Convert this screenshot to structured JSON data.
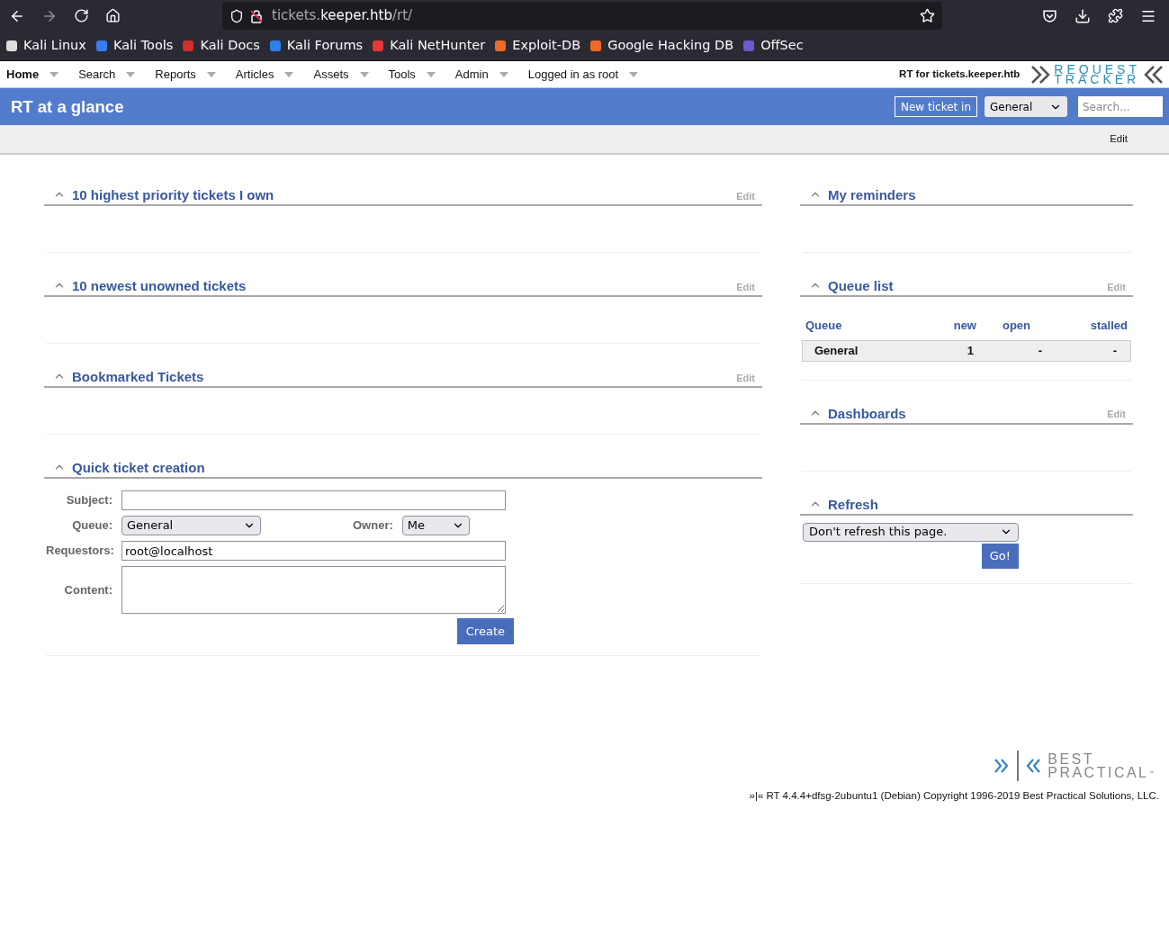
{
  "browser": {
    "url": {
      "subdomain": "tickets.",
      "domain": "keeper.htb",
      "path": "/rt/"
    },
    "bookmarks": [
      {
        "label": "Kali Linux",
        "color": "#dddddd"
      },
      {
        "label": "Kali Tools",
        "color": "#367bf0"
      },
      {
        "label": "Kali Docs",
        "color": "#d32f2f"
      },
      {
        "label": "Kali Forums",
        "color": "#2f80ed"
      },
      {
        "label": "Kali NetHunter",
        "color": "#e53935"
      },
      {
        "label": "Exploit-DB",
        "color": "#f06a2b"
      },
      {
        "label": "Google Hacking DB",
        "color": "#f06a2b"
      },
      {
        "label": "OffSec",
        "color": "#6a5acd"
      }
    ]
  },
  "menu": {
    "items": [
      {
        "label": "Home",
        "selected": true
      },
      {
        "label": "Search",
        "selected": false
      },
      {
        "label": "Reports",
        "selected": false
      },
      {
        "label": "Articles",
        "selected": false
      },
      {
        "label": "Assets",
        "selected": false
      },
      {
        "label": "Tools",
        "selected": false
      },
      {
        "label": "Admin",
        "selected": false
      },
      {
        "label": "Logged in as root",
        "selected": false
      }
    ],
    "site_title": "RT for tickets.keeper.htb",
    "logo": {
      "line1": "REQUEST",
      "line2": "TRACKER"
    }
  },
  "header": {
    "title": "RT at a glance",
    "new_ticket_button": "New ticket in",
    "queue_select": "General",
    "search_placeholder": "Search..."
  },
  "page_edit": "Edit",
  "left": [
    {
      "kind": "empty",
      "title": "10 highest priority tickets I own",
      "edit": "Edit"
    },
    {
      "kind": "empty",
      "title": "10 newest unowned tickets",
      "edit": "Edit"
    },
    {
      "kind": "empty",
      "title": "Bookmarked Tickets",
      "edit": "Edit"
    },
    {
      "kind": "form",
      "title": "Quick ticket creation",
      "form": {
        "subject_label": "Subject:",
        "queue_label": "Queue:",
        "queue_value": "General",
        "owner_label": "Owner:",
        "owner_value": "Me",
        "requestors_label": "Requestors:",
        "requestors_value": "root@localhost",
        "content_label": "Content:",
        "create_button": "Create"
      }
    }
  ],
  "right": [
    {
      "kind": "empty",
      "title": "My reminders"
    },
    {
      "kind": "table",
      "title": "Queue list",
      "edit": "Edit",
      "table": {
        "columns": [
          "Queue",
          "new",
          "open",
          "stalled"
        ],
        "rows": [
          [
            "General",
            "1",
            "-",
            "-"
          ]
        ]
      }
    },
    {
      "kind": "empty",
      "title": "Dashboards",
      "edit": "Edit"
    },
    {
      "kind": "refresh",
      "title": "Refresh",
      "select_value": "Don't refresh this page.",
      "go_button": "Go!"
    }
  ],
  "footer": {
    "logo": {
      "line1": "BEST",
      "line2": "PRACTICAL",
      "mark": "™"
    },
    "copyright": "»|« RT 4.4.4+dfsg-2ubuntu1 (Debian) Copyright 1996-2019 Best Practical Solutions, LLC."
  }
}
